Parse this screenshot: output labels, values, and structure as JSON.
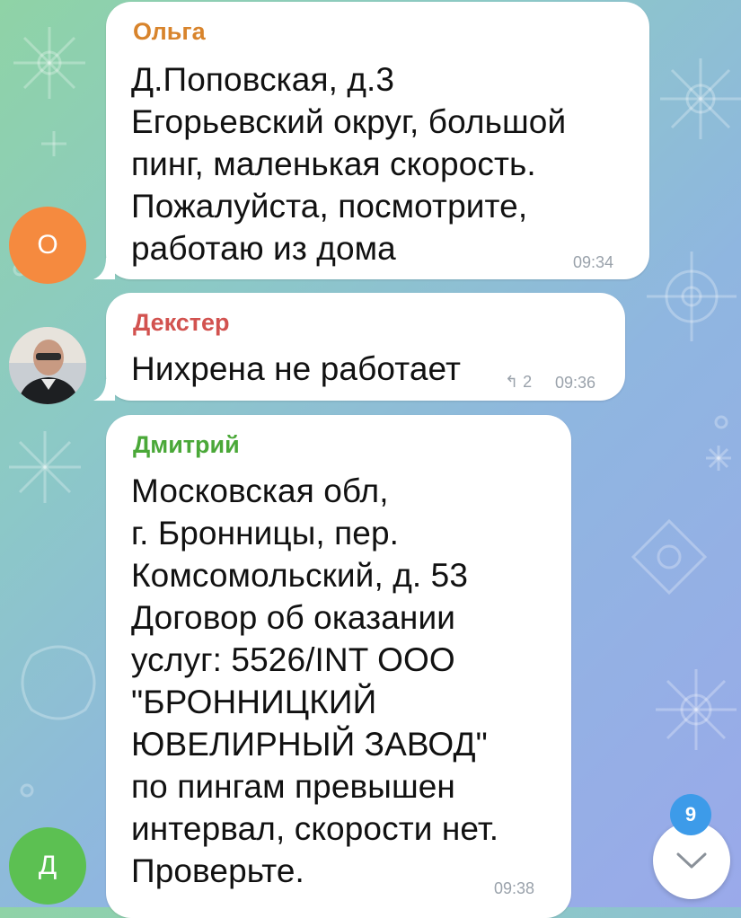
{
  "messages": [
    {
      "sender": "Ольга",
      "sender_color": "#d8842c",
      "avatar_letter": "О",
      "avatar_color": "#f58a3f",
      "text": "Д.Поповская, д.3\nЕгорьевский округ, большой\nпинг, маленькая скорость.\nПожалуйста, посмотрите,\nработаю из дома",
      "time": "09:34"
    },
    {
      "sender": "Декстер",
      "sender_color": "#d2524f",
      "avatar_icon": "user-photo",
      "text": "Нихрена не работает",
      "replies": "2",
      "time": "09:36"
    },
    {
      "sender": "Дмитрий",
      "sender_color": "#4aa838",
      "avatar_letter": "Д",
      "avatar_color": "#5cc052",
      "text": "Московская обл,\nг. Бронницы, пер.\nКомсомольский, д. 53\nДоговор об оказании\nуслуг: 5526/INT ООО\n\"БРОННИЦКИЙ\nЮВЕЛИРНЫЙ ЗАВОД\"\nпо пингам превышен\nинтервал, скорости нет.\nПроверьте.",
      "time": "09:38"
    }
  ],
  "scroll_down": {
    "unread_count": "9",
    "icon": "chevron-down-icon"
  }
}
